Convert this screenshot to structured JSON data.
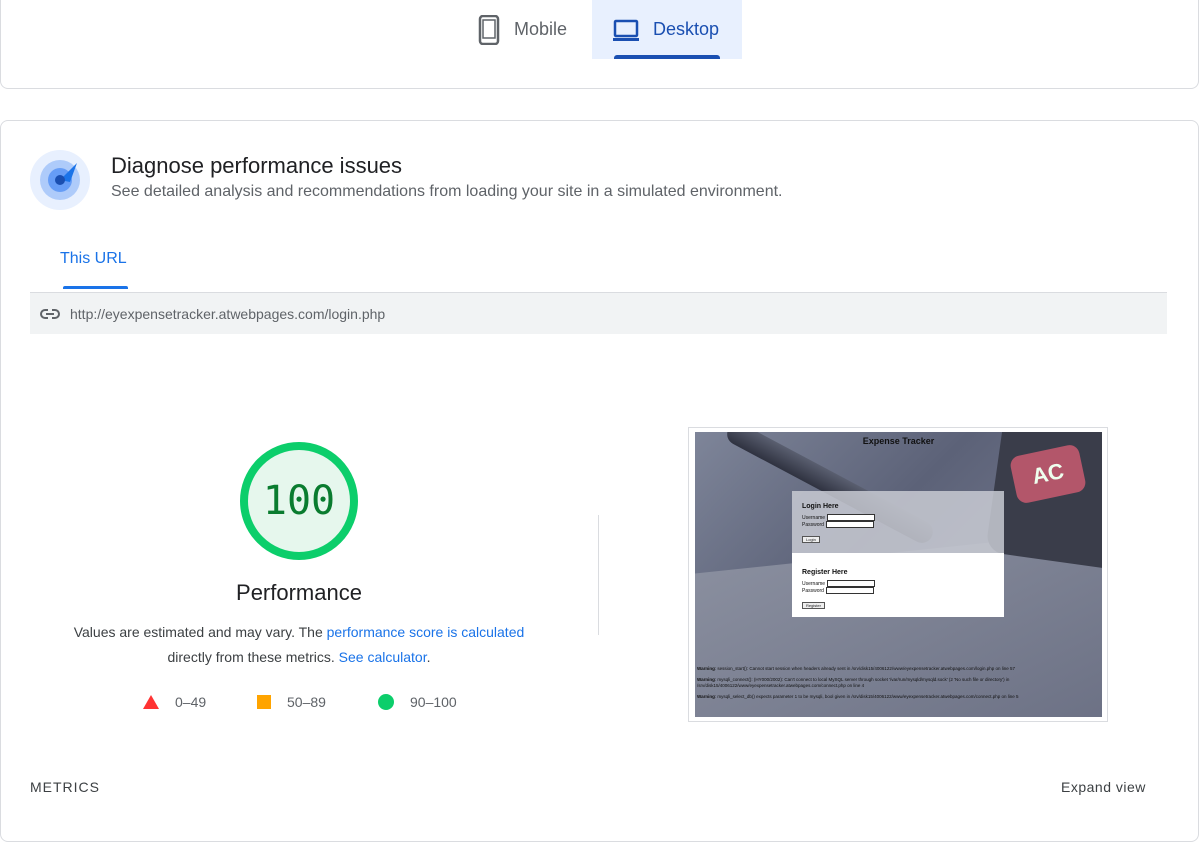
{
  "device_tabs": {
    "mobile_label": "Mobile",
    "desktop_label": "Desktop",
    "selected": "Desktop"
  },
  "diagnose": {
    "title": "Diagnose performance issues",
    "subtitle": "See detailed analysis and recommendations from loading your site in a simulated environment.",
    "icon": "gauge-icon"
  },
  "url_tab": {
    "label": "This URL"
  },
  "url_bar": {
    "icon": "link-icon",
    "url": "http://eyexpensetracker.atwebpages.com/login.php"
  },
  "performance": {
    "score": "100",
    "score_value": 100,
    "label": "Performance",
    "desc_prefix": "Values are estimated and may vary. The ",
    "desc_link1": "performance score is calculated",
    "desc_middle": "directly from these metrics. ",
    "desc_link2": "See calculator",
    "desc_suffix": ".",
    "colors": {
      "pass": "#0cce6b",
      "pass_text": "#0a7c2f",
      "average": "#ffa400",
      "fail": "#ff3333"
    }
  },
  "legend": {
    "fail": "0–49",
    "average": "50–89",
    "pass": "90–100"
  },
  "thumbnail": {
    "page_title": "Expense Tracker",
    "calc_key": "AC",
    "login_title": "Login Here",
    "register_title": "Register Here",
    "username_label": "Username",
    "password_label": "Password",
    "login_button": "Login",
    "register_button": "Register",
    "warning1_label": "Warning",
    "warning1": ": session_start(): Cannot start session when headers already sent in /srv/disk15/4006122/www/eyexpensetracker.atwebpages.com/login.php on line 57",
    "warning2_label": "Warning",
    "warning2": ": mysqli_connect(): (HY000/2002): Can't connect to local MySQL server through socket '/var/run/mysqld/mysqld.sock' (2 'No such file or directory') in /srv/disk15/4006122/www/eyexpensetracker.atwebpages.com/connect.php on line 4",
    "warning3_label": "Warning",
    "warning3": ": mysqli_select_db() expects parameter 1 to be mysqli, bool given in /srv/disk15/4006122/www/eyexpensetracker.atwebpages.com/connect.php on line 5"
  },
  "metrics": {
    "label": "METRICS",
    "expand": "Expand view"
  }
}
